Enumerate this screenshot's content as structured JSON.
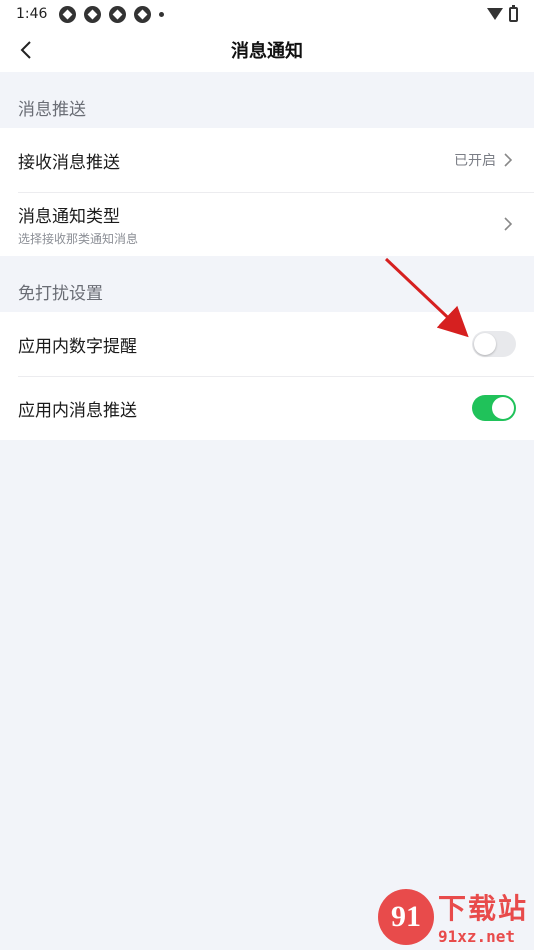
{
  "status_bar": {
    "time": "1:46"
  },
  "header": {
    "title": "消息通知"
  },
  "sections": [
    {
      "header": "消息推送",
      "rows": [
        {
          "label": "接收消息推送",
          "value": "已开启",
          "control": "chevron"
        },
        {
          "label": "消息通知类型",
          "subtitle": "选择接收那类通知消息",
          "control": "chevron"
        }
      ]
    },
    {
      "header": "免打扰设置",
      "rows": [
        {
          "label": "应用内数字提醒",
          "control": "toggle",
          "state": "off"
        },
        {
          "label": "应用内消息推送",
          "control": "toggle",
          "state": "on"
        }
      ]
    }
  ],
  "watermark": {
    "logo": "91",
    "text_cn": "下载站",
    "text_en": "91xz.net"
  },
  "colors": {
    "toggle_on": "#20c25a",
    "toggle_off": "#e8e9ec",
    "arrow": "#d62020",
    "watermark": "#e84b4b"
  }
}
